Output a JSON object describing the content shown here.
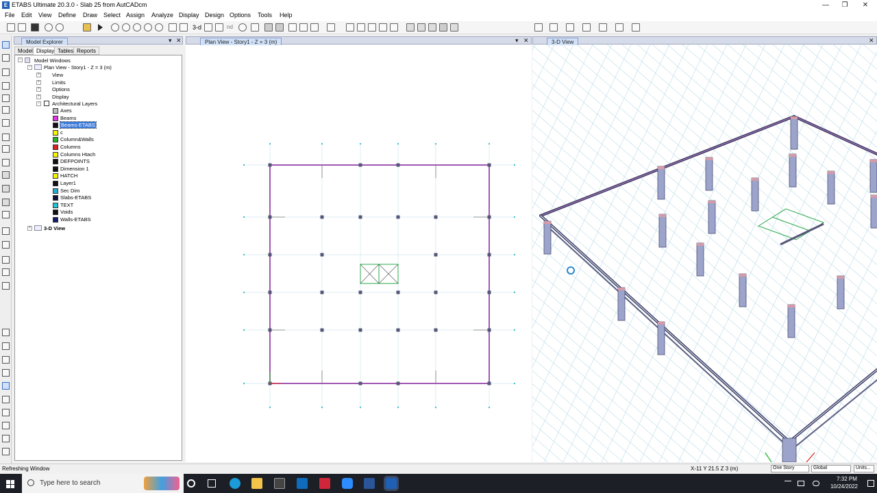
{
  "title_bar": {
    "app_icon_letter": "E",
    "title": "ETABS Ultimate 20.3.0 - Slab 25 from AutCADcm",
    "minimize": "—",
    "restore": "❐",
    "close": "✕"
  },
  "menu": [
    "File",
    "Edit",
    "View",
    "Define",
    "Draw",
    "Select",
    "Assign",
    "Analyze",
    "Display",
    "Design",
    "Options",
    "Tools",
    "Help"
  ],
  "toolbar": {
    "threed_label": "3-d",
    "nd_label": "nd"
  },
  "explorer": {
    "title": "Model Explorer",
    "tabs": [
      "Model",
      "Display",
      "Tables",
      "Reports"
    ],
    "root": "Model Windows",
    "plan_node": "Plan View - Story1 - Z = 3 (m)",
    "children": [
      "View",
      "Limits",
      "Options",
      "Display"
    ],
    "arch_layers": "Architectural Layers",
    "layers": [
      {
        "name": "Axes",
        "color": "#bdbdbd"
      },
      {
        "name": "Beams",
        "color": "#e535e5"
      },
      {
        "name": "Beams-ETABS",
        "color": "#111111"
      },
      {
        "name": "c",
        "color": "#f5f500"
      },
      {
        "name": "Column&Walls",
        "color": "#28b428"
      },
      {
        "name": "Columns",
        "color": "#e02020"
      },
      {
        "name": "Columns Htach",
        "color": "#f5f500"
      },
      {
        "name": "DEFPOINTS",
        "color": "#111111"
      },
      {
        "name": "Dimension 1",
        "color": "#111111"
      },
      {
        "name": "HATCH",
        "color": "#f5f500"
      },
      {
        "name": "Layer1",
        "color": "#111111"
      },
      {
        "name": "Sec Dim",
        "color": "#22b0d0"
      },
      {
        "name": "Slabs-ETABS",
        "color": "#111133"
      },
      {
        "name": "TEXT",
        "color": "#22c8d8"
      },
      {
        "name": "Voids",
        "color": "#111111"
      },
      {
        "name": "Walls-ETABS",
        "color": "#121a6a"
      }
    ],
    "view3d_node": "3-D View",
    "pin": "▾",
    "close": "✕"
  },
  "plan_view": {
    "title": "Plan View - Story1 - Z = 3 (m)"
  },
  "view3d": {
    "title": "3-D View"
  },
  "status": {
    "left": "Refreshing Window",
    "coords": "X-11  Y 21.5  Z 3 (m)",
    "story_select": "One Story",
    "coord_select": "Global",
    "units_button": "Units..."
  },
  "taskbar": {
    "search_placeholder": "Type here to search",
    "time": "7:32 PM",
    "date": "10/24/2022"
  },
  "colors": {
    "frame": "#9b3fa8",
    "grid": "#a8d4e4",
    "column": "#555577"
  }
}
